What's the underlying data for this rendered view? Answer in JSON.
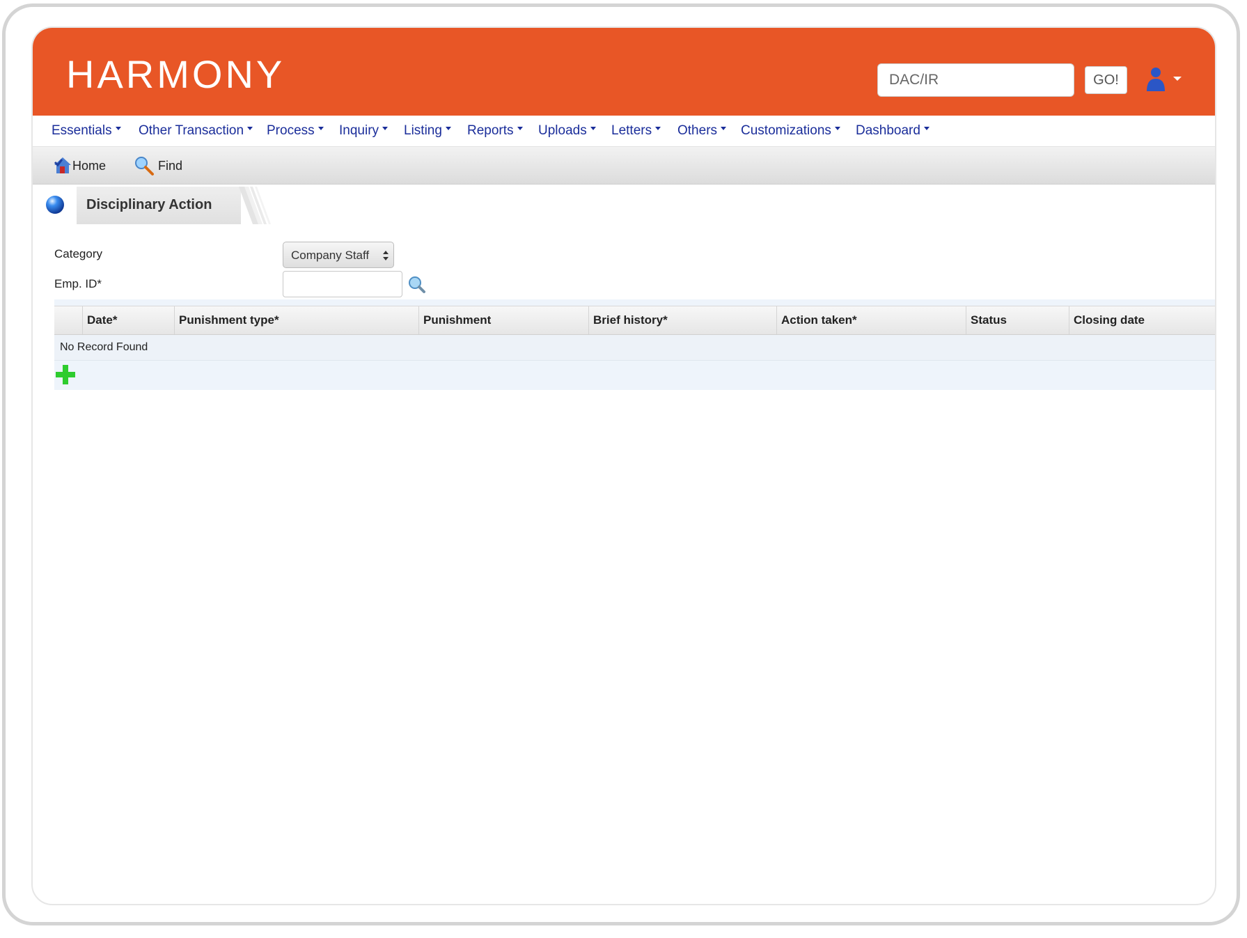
{
  "header": {
    "logo": "HARMONY",
    "search_placeholder": "DAC/IR",
    "go_label": "GO!"
  },
  "nav": [
    {
      "label": "Essentials"
    },
    {
      "label": "Other Transaction"
    },
    {
      "label": "Process"
    },
    {
      "label": "Inquiry"
    },
    {
      "label": "Listing"
    },
    {
      "label": "Reports"
    },
    {
      "label": "Uploads"
    },
    {
      "label": "Letters"
    },
    {
      "label": "Others"
    },
    {
      "label": "Customizations"
    },
    {
      "label": "Dashboard"
    }
  ],
  "toolbar": {
    "home_label": "Home",
    "find_label": "Find"
  },
  "page": {
    "title": "Disciplinary Action"
  },
  "form": {
    "category_label": "Category",
    "category_value": "Company Staff",
    "emp_id_label": "Emp. ID*",
    "emp_id_value": ""
  },
  "grid": {
    "columns": [
      "Date*",
      "Punishment type*",
      "Punishment",
      "Brief history*",
      "Action taken*",
      "Status",
      "Closing date"
    ],
    "empty_message": "No Record Found"
  },
  "colors": {
    "brand": "#e85626",
    "nav_text": "#1a2d9a",
    "add_icon": "#2ecc2e"
  }
}
